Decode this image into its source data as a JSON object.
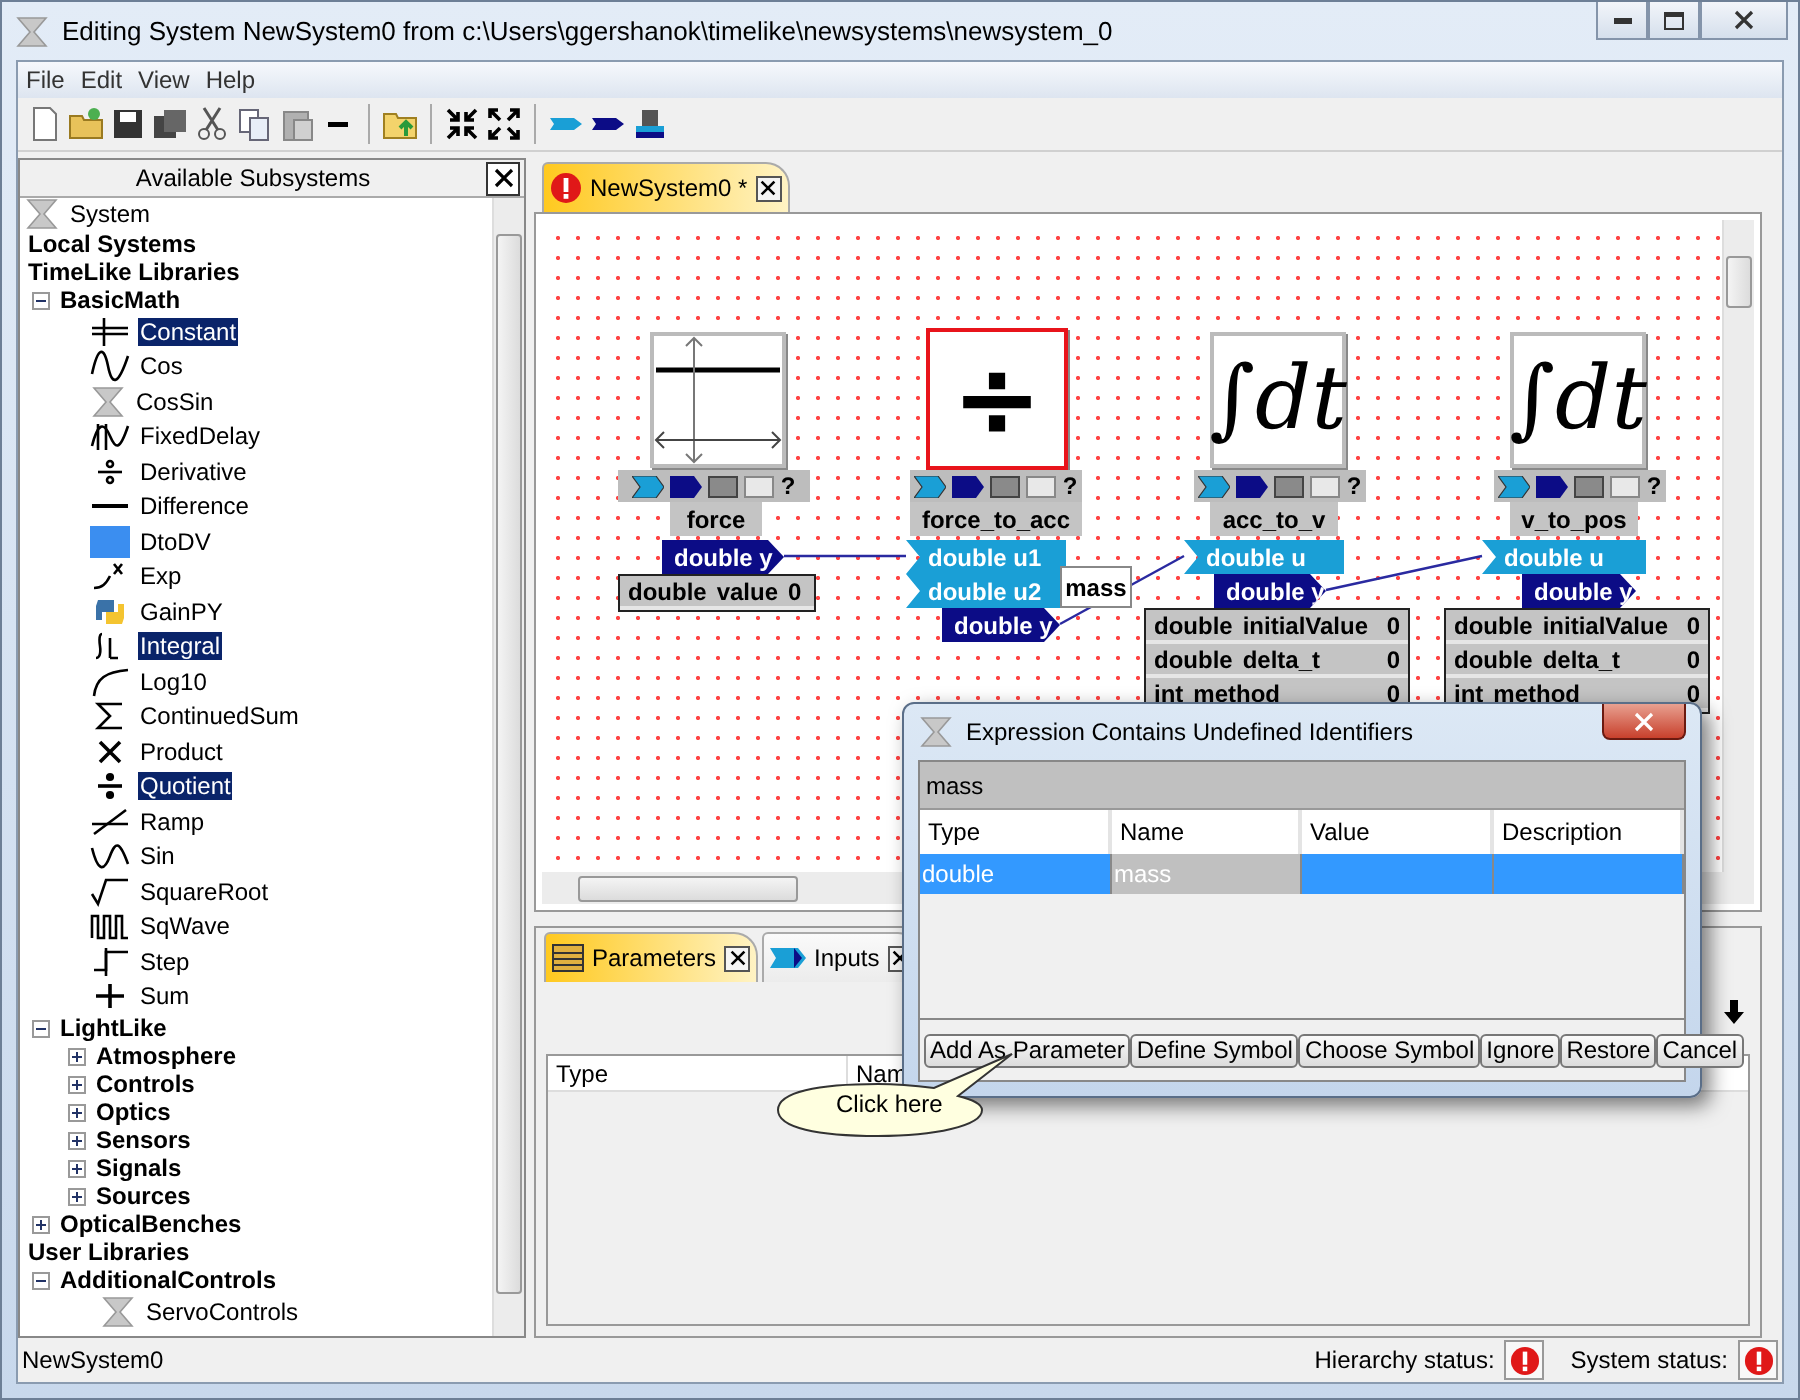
{
  "window": {
    "title": "Editing System NewSystem0 from c:\\Users\\ggershanok\\timelike\\newsystems\\newsystem_0"
  },
  "menu": [
    "File",
    "Edit",
    "View",
    "Help"
  ],
  "subsystems": {
    "title": "Available Subsystems",
    "tree": [
      {
        "label": "System",
        "kind": "system"
      },
      {
        "label": "Local Systems",
        "kind": "header"
      },
      {
        "label": "TimeLike Libraries",
        "kind": "header",
        "children": [
          {
            "label": "BasicMath",
            "kind": "folder",
            "expanded": true,
            "children": [
              {
                "label": "Constant",
                "kind": "leaf",
                "selected": true
              },
              {
                "label": "Cos",
                "kind": "leaf",
                "selected": false
              },
              {
                "label": "CosSin",
                "kind": "leaf",
                "selected": false
              },
              {
                "label": "FixedDelay",
                "kind": "leaf",
                "selected": false
              },
              {
                "label": "Derivative",
                "kind": "leaf",
                "selected": false
              },
              {
                "label": "Difference",
                "kind": "leaf",
                "selected": false
              },
              {
                "label": "DtoDV",
                "kind": "leaf",
                "selected": false
              },
              {
                "label": "Exp",
                "kind": "leaf",
                "selected": false
              },
              {
                "label": "GainPY",
                "kind": "leaf",
                "selected": false
              },
              {
                "label": "Integral",
                "kind": "leaf",
                "selected": true
              },
              {
                "label": "Log10",
                "kind": "leaf",
                "selected": false
              },
              {
                "label": "ContinuedSum",
                "kind": "leaf",
                "selected": false
              },
              {
                "label": "Product",
                "kind": "leaf",
                "selected": false
              },
              {
                "label": "Quotient",
                "kind": "leaf",
                "selected": true
              },
              {
                "label": "Ramp",
                "kind": "leaf",
                "selected": false
              },
              {
                "label": "Sin",
                "kind": "leaf",
                "selected": false
              },
              {
                "label": "SquareRoot",
                "kind": "leaf",
                "selected": false
              },
              {
                "label": "SqWave",
                "kind": "leaf",
                "selected": false
              },
              {
                "label": "Step",
                "kind": "leaf",
                "selected": false
              },
              {
                "label": "Sum",
                "kind": "leaf",
                "selected": false
              }
            ]
          },
          {
            "label": "LightLike",
            "kind": "folder",
            "expanded": true,
            "children": [
              {
                "label": "Atmosphere",
                "kind": "folder",
                "expanded": false
              },
              {
                "label": "Controls",
                "kind": "folder",
                "expanded": false
              },
              {
                "label": "Optics",
                "kind": "folder",
                "expanded": false
              },
              {
                "label": "Sensors",
                "kind": "folder",
                "expanded": false
              },
              {
                "label": "Signals",
                "kind": "folder",
                "expanded": false
              },
              {
                "label": "Sources",
                "kind": "folder",
                "expanded": false
              }
            ]
          },
          {
            "label": "OpticalBenches",
            "kind": "folder",
            "expanded": false
          }
        ]
      },
      {
        "label": "User Libraries",
        "kind": "header",
        "children": [
          {
            "label": "AdditionalControls",
            "kind": "folder",
            "expanded": true,
            "children": [
              {
                "label": "ServoControls",
                "kind": "system"
              }
            ]
          }
        ]
      }
    ]
  },
  "editor_tabs": [
    {
      "label": "NewSystem0 *",
      "selected": true,
      "error": true
    }
  ],
  "canvas": {
    "blocks": [
      {
        "name": "force",
        "selected": false,
        "icon": {
          "kind": "constant"
        },
        "help": "?",
        "outputs": [
          "double y"
        ],
        "params": [
          {
            "type": "double",
            "name": "value",
            "value": "0"
          }
        ]
      },
      {
        "name": "force_to_acc",
        "selected": true,
        "icon": {
          "kind": "glyph",
          "text": "÷"
        },
        "help": "?",
        "inputs": [
          "double u1",
          "double u2"
        ],
        "outputs": [
          "double y"
        ]
      },
      {
        "name": "acc_to_v",
        "selected": false,
        "icon": {
          "kind": "glyph",
          "text": "∫dt"
        },
        "help": "?",
        "inputs": [
          "double u"
        ],
        "outputs": [
          "double y"
        ],
        "params": [
          {
            "type": "double",
            "name": "initialValue",
            "value": "0"
          },
          {
            "type": "double",
            "name": "delta_t",
            "value": "0"
          },
          {
            "type": "int",
            "name": "method",
            "value": "0"
          }
        ]
      },
      {
        "name": "v_to_pos",
        "selected": false,
        "icon": {
          "kind": "glyph",
          "text": "∫dt"
        },
        "help": "?",
        "inputs": [
          "double u"
        ],
        "outputs": [
          "double y"
        ],
        "params": [
          {
            "type": "double",
            "name": "initialValue",
            "value": "0"
          },
          {
            "type": "double",
            "name": "delta_t",
            "value": "0"
          },
          {
            "type": "int",
            "name": "method",
            "value": "0"
          }
        ]
      }
    ],
    "hover_label": "mass"
  },
  "bottom_tabs": [
    {
      "label": "Parameters",
      "kind": "parameters",
      "selected": true
    },
    {
      "label": "Inputs",
      "kind": "inputs",
      "selected": false
    }
  ],
  "parameters_table": {
    "columns": [
      "Type",
      "Nam"
    ]
  },
  "status_bar": {
    "system": "NewSystem0",
    "hierarchy_label": "Hierarchy status:",
    "system_label": "System status:"
  },
  "dialog": {
    "title": "Expression Contains Undefined Identifiers",
    "expression": "mass",
    "columns": [
      "Type",
      "Name",
      "Value",
      "Description"
    ],
    "rows": [
      {
        "selected": true,
        "cells": [
          {
            "text": "double",
            "readonly": false
          },
          {
            "text": "mass",
            "readonly": true
          },
          {
            "readonly": false
          },
          {
            "readonly": false
          }
        ]
      }
    ],
    "buttons": [
      "Add As Parameter",
      "Define Symbol",
      "Choose Symbol",
      "Ignore",
      "Restore",
      "Cancel"
    ]
  },
  "callout": {
    "text": "Click here"
  }
}
